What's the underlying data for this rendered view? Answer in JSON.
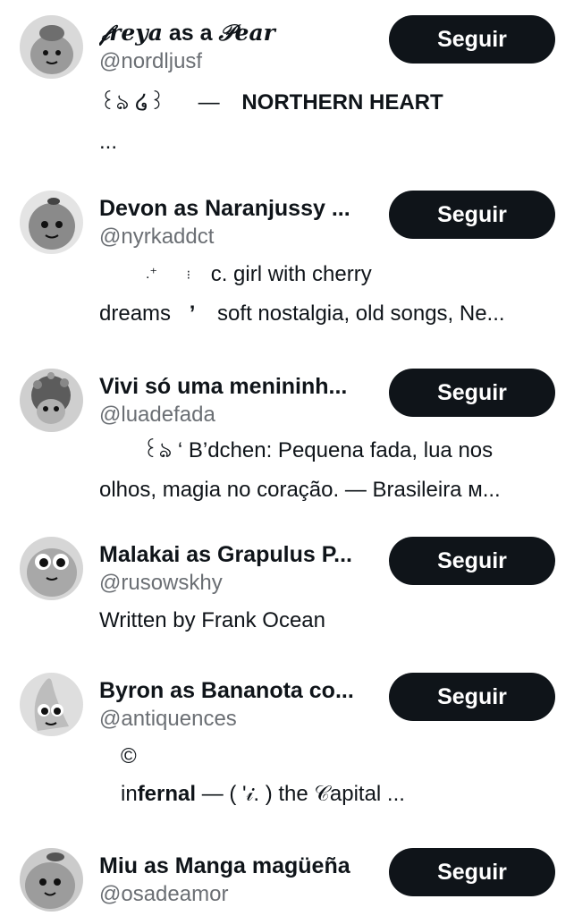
{
  "follow_label": "Seguir",
  "users": [
    {
      "name_a": "𝒻reya",
      "name_b": " as a ",
      "name_c": "𝒫ear",
      "handle": "@nordljusf",
      "bio_line1_a": "꒰ঌ ໒꒱",
      "bio_line1_b": "—",
      "bio_line1_c": "NORTHERN HEART",
      "bio_line2": "..."
    },
    {
      "name_a": "Devon",
      "name_b": " as Naranjussy ...",
      "handle": "@nyrkaddct",
      "bio_line1_a": ".⁺",
      "bio_line1_b": "⁝",
      "bio_line1_c": "ᴄ. girl with cherry",
      "bio_line2_a": "dreams",
      "bio_line2_b": "’",
      "bio_line2_c": "soft nostalgia, old songs, Ne..."
    },
    {
      "name": "Vivi só uma menininh...",
      "handle": "@luadefada",
      "bio_line1": "꒰ঌ ‘ B’dchen: Pequena fada, lua nos",
      "bio_line2": "olhos, magia no coração. — Brasileira ᴍ..."
    },
    {
      "name": "Malakai as Grapulus P...",
      "handle": "@rusowskhy",
      "bio_line1": "Written by Frank Ocean"
    },
    {
      "name": "Byron as Bananota co...",
      "handle": "@antiquences",
      "bio_line1": "©",
      "bio_line2_a": "in",
      "bio_line2_b": "fernal",
      "bio_line2_c": " — ( '𝒾. ) the 𝒞apital ..."
    },
    {
      "name": "Miu as Manga magüeña",
      "handle": "@osadeamor"
    }
  ]
}
